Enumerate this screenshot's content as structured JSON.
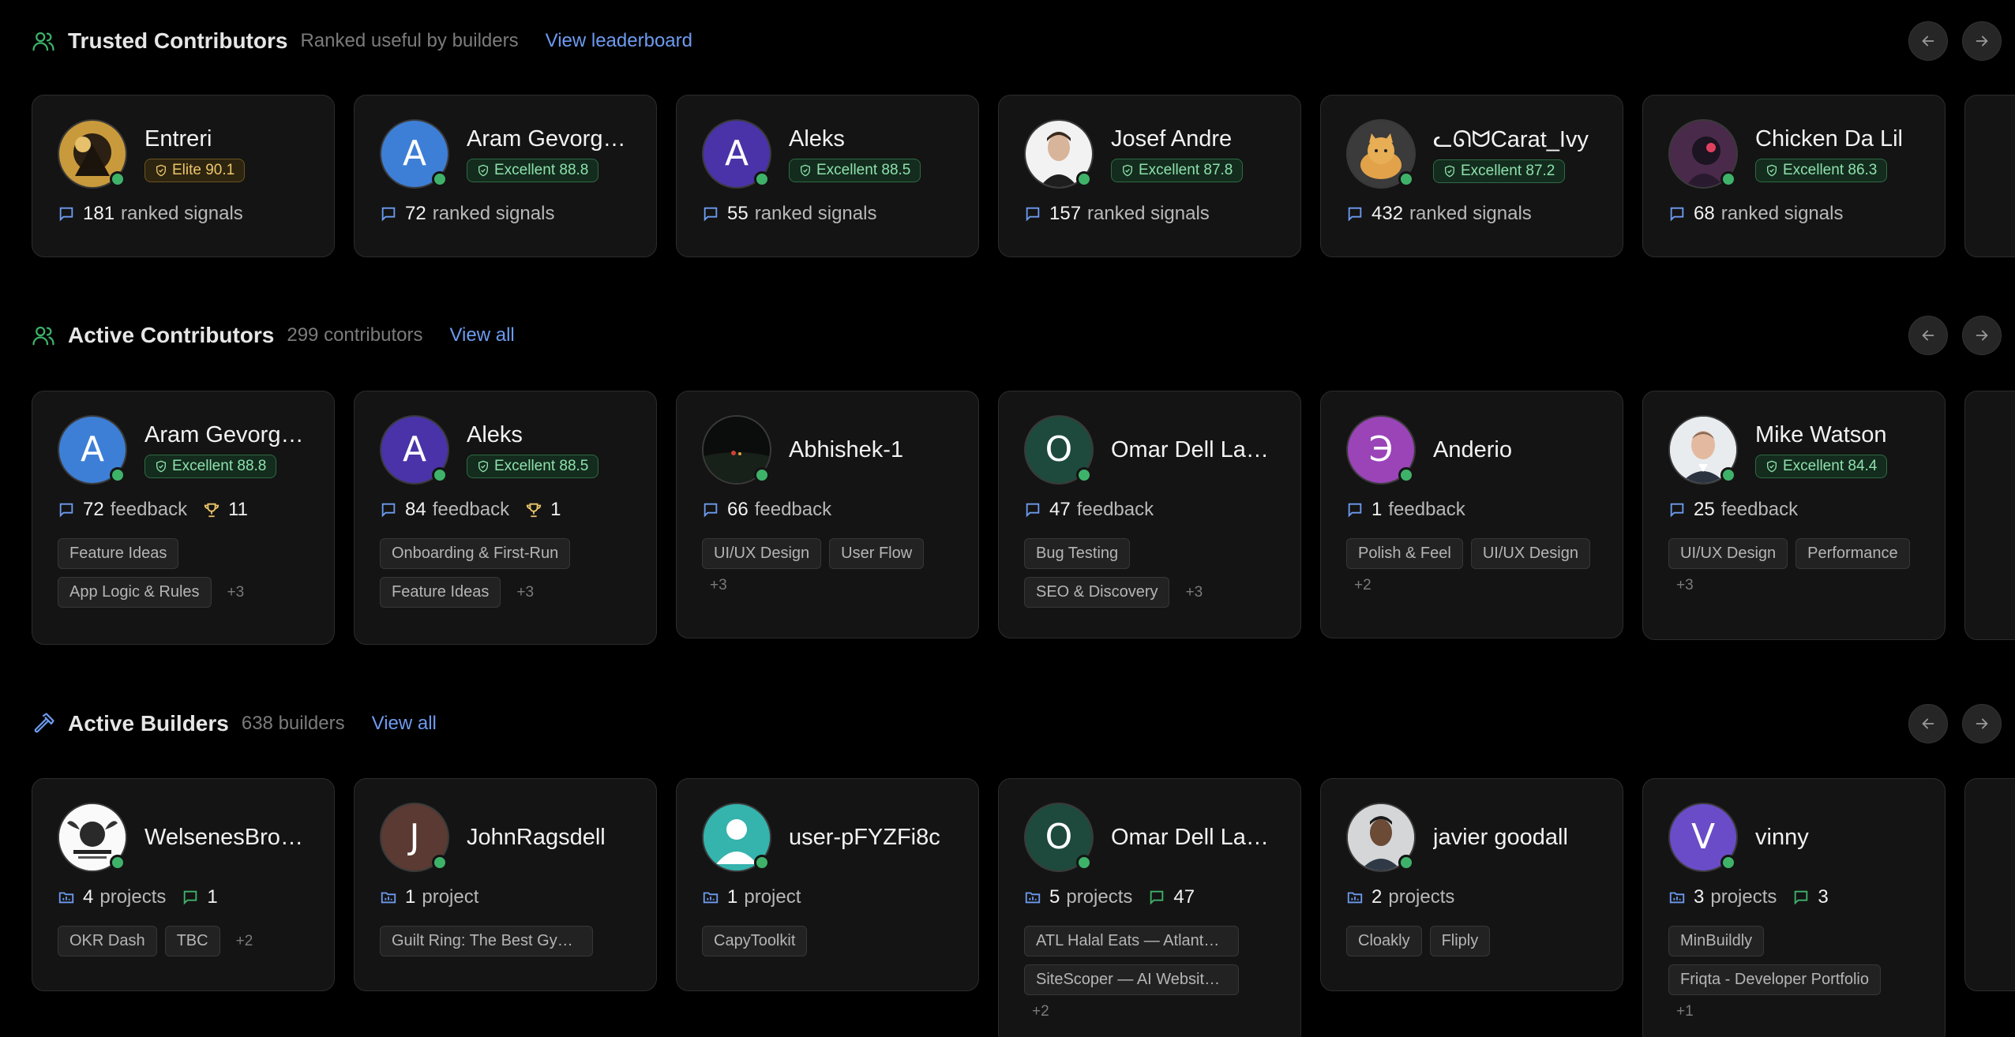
{
  "trusted": {
    "title": "Trusted Contributors",
    "subtitle": "Ranked useful by builders",
    "link": "View leaderboard",
    "cards": [
      {
        "name": "Entreri",
        "initial": "",
        "badge": "Elite 90.1",
        "tier": "elite",
        "count": "181",
        "label": "ranked signals"
      },
      {
        "name": "Aram Gevorgyan",
        "initial": "A",
        "badge": "Excellent 88.8",
        "tier": "excellent",
        "count": "72",
        "label": "ranked signals"
      },
      {
        "name": "Aleks",
        "initial": "A",
        "badge": "Excellent 88.5",
        "tier": "excellent",
        "count": "55",
        "label": "ranked signals"
      },
      {
        "name": "Josef Andre",
        "initial": "",
        "badge": "Excellent 87.8",
        "tier": "excellent",
        "count": "157",
        "label": "ranked signals"
      },
      {
        "name": "ᓚᘏᗢCarat_Ivy",
        "initial": "",
        "badge": "Excellent 87.2",
        "tier": "excellent",
        "count": "432",
        "label": "ranked signals"
      },
      {
        "name": "Chicken Da Lil",
        "initial": "",
        "badge": "Excellent 86.3",
        "tier": "excellent",
        "count": "68",
        "label": "ranked signals"
      }
    ]
  },
  "active_contributors": {
    "title": "Active Contributors",
    "subtitle": "299 contributors",
    "link": "View all",
    "cards": [
      {
        "name": "Aram Gevorgyan",
        "initial": "A",
        "badge": "Excellent 88.8",
        "feedback": "72",
        "feedback_label": "feedback",
        "trophies": "11",
        "tags": [
          "Feature Ideas",
          "App Logic & Rules"
        ],
        "more": "+3"
      },
      {
        "name": "Aleks",
        "initial": "A",
        "badge": "Excellent 88.5",
        "feedback": "84",
        "feedback_label": "feedback",
        "trophies": "1",
        "tags": [
          "Onboarding & First-Run",
          "Feature Ideas"
        ],
        "more": "+3"
      },
      {
        "name": "Abhishek-1",
        "initial": "",
        "badge": "",
        "feedback": "66",
        "feedback_label": "feedback",
        "trophies": "",
        "tags": [
          "UI/UX Design",
          "User Flow"
        ],
        "more": "+3"
      },
      {
        "name": "Omar Dell Laptop",
        "initial": "O",
        "badge": "",
        "feedback": "47",
        "feedback_label": "feedback",
        "trophies": "",
        "tags": [
          "Bug Testing",
          "SEO & Discovery"
        ],
        "more": "+3"
      },
      {
        "name": "Anderio",
        "initial": "Э",
        "badge": "",
        "feedback": "1",
        "feedback_label": "feedback",
        "trophies": "",
        "tags": [
          "Polish & Feel",
          "UI/UX Design"
        ],
        "more": "+2"
      },
      {
        "name": "Mike Watson",
        "initial": "",
        "badge": "Excellent 84.4",
        "feedback": "25",
        "feedback_label": "feedback",
        "trophies": "",
        "tags": [
          "UI/UX Design",
          "Performance"
        ],
        "more": "+3"
      }
    ]
  },
  "active_builders": {
    "title": "Active Builders",
    "subtitle": "638 builders",
    "link": "View all",
    "cards": [
      {
        "name": "WelsenesBrothers",
        "initial": "",
        "projects": "4",
        "projects_label": "projects",
        "comments": "1",
        "tags": [
          "OKR Dash",
          "TBC"
        ],
        "more": "+2"
      },
      {
        "name": "JohnRagsdell",
        "initial": "J",
        "projects": "1",
        "projects_label": "project",
        "comments": "",
        "tags": [
          "Guilt Ring: The Best Gym App"
        ],
        "more": ""
      },
      {
        "name": "user-pFYZFi8c",
        "initial": "",
        "projects": "1",
        "projects_label": "project",
        "comments": "",
        "tags": [
          "CapyToolkit"
        ],
        "more": ""
      },
      {
        "name": "Omar Dell Laptop",
        "initial": "O",
        "projects": "5",
        "projects_label": "projects",
        "comments": "47",
        "tags": [
          "ATL Halal Eats — Atlanta Guide",
          "SiteScoper — AI Website Audit"
        ],
        "more": "+2"
      },
      {
        "name": "javier goodall",
        "initial": "",
        "projects": "2",
        "projects_label": "projects",
        "comments": "",
        "tags": [
          "Cloakly",
          "Fliply"
        ],
        "more": ""
      },
      {
        "name": "vinny",
        "initial": "V",
        "projects": "3",
        "projects_label": "projects",
        "comments": "3",
        "tags": [
          "MinBuildly",
          "Friqta - Developer Portfolio"
        ],
        "more": "+1"
      }
    ]
  },
  "colors": {
    "accent_link": "#6d9bf0",
    "online": "#3fb26a",
    "excellent": "#8ee0ad",
    "elite": "#ecc66a"
  }
}
